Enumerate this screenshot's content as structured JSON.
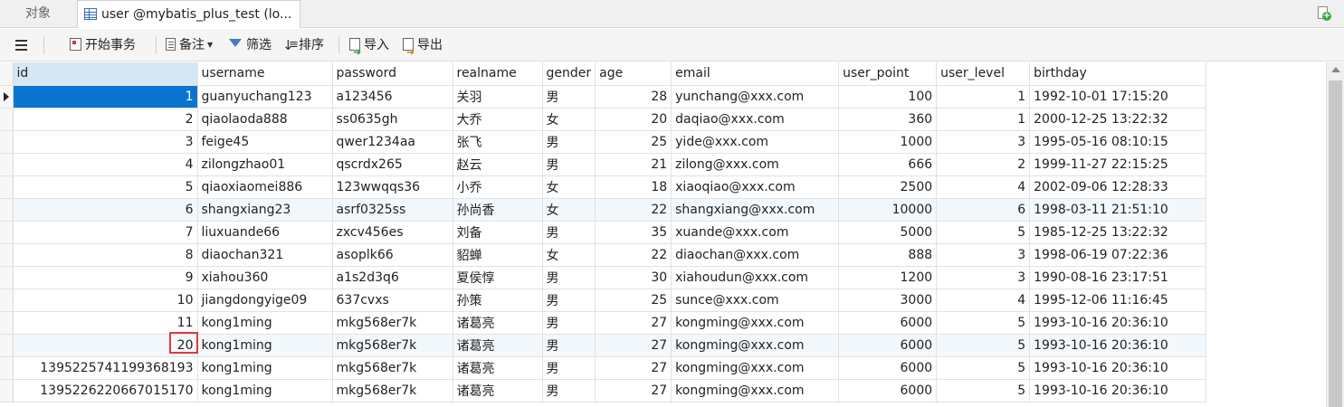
{
  "tabs": {
    "objects_label": "对象",
    "active_label": "user @mybatis_plus_test (lo..."
  },
  "toolbar": {
    "begin_transaction": "开始事务",
    "memo": "备注",
    "filter": "筛选",
    "sort": "排序",
    "import": "导入",
    "export": "导出"
  },
  "table": {
    "columns": [
      "id",
      "username",
      "password",
      "realname",
      "gender",
      "age",
      "email",
      "user_point",
      "user_level",
      "birthday"
    ],
    "rows": [
      [
        "1",
        "guanyuchang123",
        "a123456",
        "关羽",
        "男",
        "28",
        "yunchang@xxx.com",
        "100",
        "1",
        "1992-10-01 17:15:20"
      ],
      [
        "2",
        "qiaolaoda888",
        "ss0635gh",
        "大乔",
        "女",
        "20",
        "daqiao@xxx.com",
        "360",
        "1",
        "2000-12-25 13:22:32"
      ],
      [
        "3",
        "feige45",
        "qwer1234aa",
        "张飞",
        "男",
        "25",
        "yide@xxx.com",
        "1000",
        "3",
        "1995-05-16 08:10:15"
      ],
      [
        "4",
        "zilongzhao01",
        "qscrdx265",
        "赵云",
        "男",
        "21",
        "zilong@xxx.com",
        "666",
        "2",
        "1999-11-27 22:15:25"
      ],
      [
        "5",
        "qiaoxiaomei886",
        "123wwqqs36",
        "小乔",
        "女",
        "18",
        "xiaoqiao@xxx.com",
        "2500",
        "4",
        "2002-09-06 12:28:33"
      ],
      [
        "6",
        "shangxiang23",
        "asrf0325ss",
        "孙尚香",
        "女",
        "22",
        "shangxiang@xxx.com",
        "10000",
        "6",
        "1998-03-11 21:51:10"
      ],
      [
        "7",
        "liuxuande66",
        "zxcv456es",
        "刘备",
        "男",
        "35",
        "xuande@xxx.com",
        "5000",
        "5",
        "1985-12-25 13:22:32"
      ],
      [
        "8",
        "diaochan321",
        "asoplk66",
        "貂蝉",
        "女",
        "22",
        "diaochan@xxx.com",
        "888",
        "3",
        "1998-06-19 07:22:36"
      ],
      [
        "9",
        "xiahou360",
        "a1s2d3q6",
        "夏侯惇",
        "男",
        "30",
        "xiahoudun@xxx.com",
        "1200",
        "3",
        "1990-08-16 23:17:51"
      ],
      [
        "10",
        "jiangdongyige09",
        "637cvxs",
        "孙策",
        "男",
        "25",
        "sunce@xxx.com",
        "3000",
        "4",
        "1995-12-06 11:16:45"
      ],
      [
        "11",
        "kong1ming",
        "mkg568er7k",
        "诸葛亮",
        "男",
        "27",
        "kongming@xxx.com",
        "6000",
        "5",
        "1993-10-16 20:36:10"
      ],
      [
        "20",
        "kong1ming",
        "mkg568er7k",
        "诸葛亮",
        "男",
        "27",
        "kongming@xxx.com",
        "6000",
        "5",
        "1993-10-16 20:36:10"
      ],
      [
        "1395225741199368193",
        "kong1ming",
        "mkg568er7k",
        "诸葛亮",
        "男",
        "27",
        "kongming@xxx.com",
        "6000",
        "5",
        "1993-10-16 20:36:10"
      ],
      [
        "1395226220667015170",
        "kong1ming",
        "mkg568er7k",
        "诸葛亮",
        "男",
        "27",
        "kongming@xxx.com",
        "6000",
        "5",
        "1993-10-16 20:36:10"
      ]
    ]
  },
  "icons": {
    "table_tab": "table-icon",
    "new_tab": "new-query-icon",
    "menu": "hamburger-menu-icon"
  },
  "colors": {
    "selection": "#0a75d1",
    "highlight_box": "#e23a3a",
    "header_selected": "#d7e6f5"
  }
}
